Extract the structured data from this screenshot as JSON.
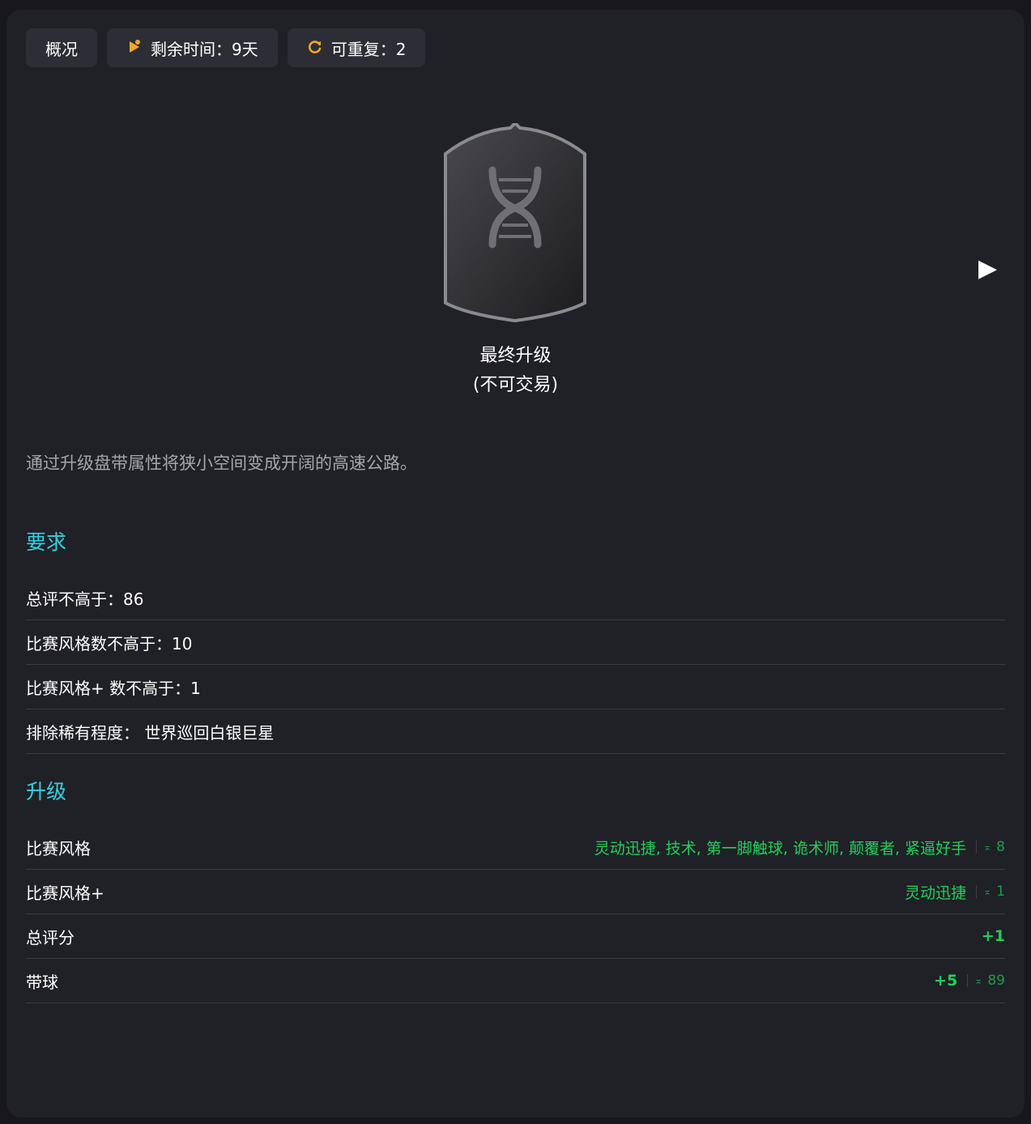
{
  "tabs": {
    "overview": "概况",
    "time_left": "剩余时间：9天",
    "repeatable": "可重复：2"
  },
  "card": {
    "title": "最终升级",
    "subtitle": "(不可交易)"
  },
  "description": "通过升级盘带属性将狭小空间变成开阔的高速公路。",
  "requirements": {
    "heading": "要求",
    "items": [
      "总评不高于：86",
      "比赛风格数不高于：10",
      "比赛风格+ 数不高于：1",
      "排除稀有程度：  世界巡回白银巨星"
    ]
  },
  "upgrades": {
    "heading": "升级",
    "items": [
      {
        "label": "比赛风格",
        "value": "灵动迅捷, 技术, 第一脚触球, 诡术师, 颠覆者, 紧逼好手",
        "cap": "8"
      },
      {
        "label": "比赛风格+",
        "value": "灵动迅捷",
        "cap": "1"
      },
      {
        "label": "总评分",
        "value": "+1",
        "cap": ""
      },
      {
        "label": "带球",
        "value": "+5",
        "cap": "89"
      }
    ]
  },
  "icons": {
    "timer": "timer-play-icon",
    "repeat": "repeat-icon",
    "next": "play-arrow-icon",
    "cap": "cap-arrow-icon",
    "dna": "dna-icon"
  },
  "colors": {
    "accent": "#2fd2e0",
    "positive": "#1fd05a",
    "icon_orange": "#f5a623"
  }
}
